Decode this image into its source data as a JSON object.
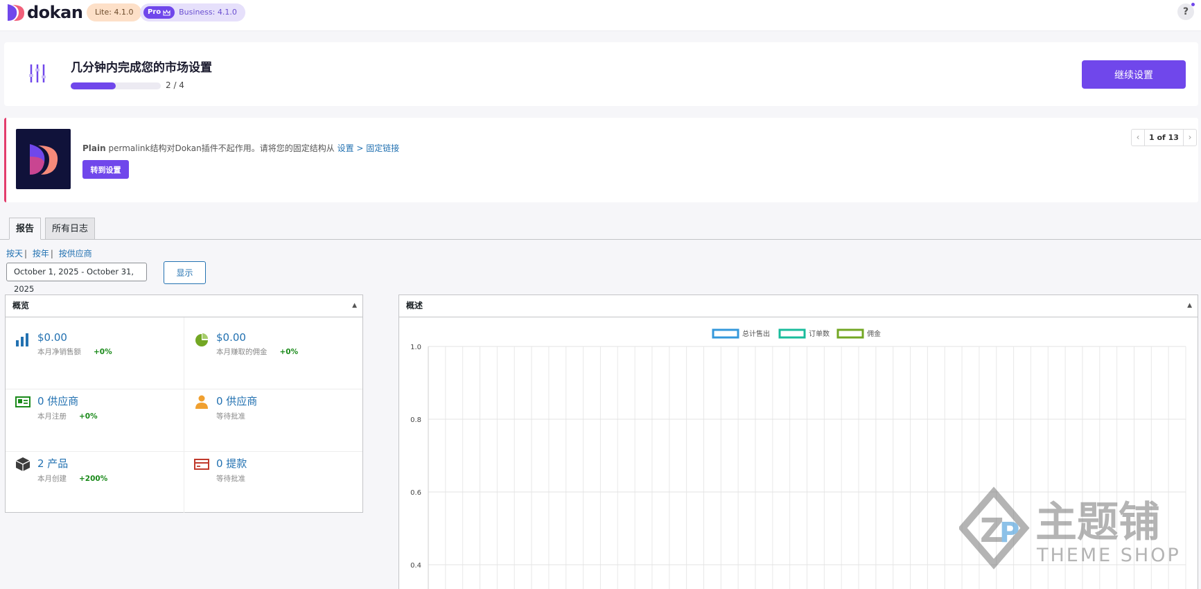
{
  "header": {
    "logo_text": "dokan",
    "lite_badge": "Lite: 4.1.0",
    "pro_label": "Pro",
    "business_badge": "Business: 4.1.0",
    "help_label": "?"
  },
  "setup": {
    "title": "几分钟内完成您的市场设置",
    "progress_text": "2 / 4",
    "progress_fraction": 0.5,
    "continue_label": "继续设置"
  },
  "notice": {
    "strong": "Plain",
    "text": " permalink结构对Dokan插件不起作用。请将您的固定结构从 ",
    "link1": "设置",
    "sep": " > ",
    "link2": "固定链接",
    "button_label": "转到设置",
    "pager_count": "1 of 13"
  },
  "tabs": [
    {
      "label": "报告",
      "active": true
    },
    {
      "label": "所有日志",
      "active": false
    }
  ],
  "sublinks": [
    "按天",
    "按年",
    "按供应商"
  ],
  "filter": {
    "date_range": "October 1, 2025 - October 31, 2025",
    "show_label": "显示"
  },
  "overview": {
    "title": "概览",
    "stats": [
      {
        "icon": "bar-chart-icon",
        "value": "$0.00",
        "label": "本月净销售额",
        "change": "+0%"
      },
      {
        "icon": "pie-chart-icon",
        "value": "$0.00",
        "label": "本月赚取的佣金",
        "change": "+0%"
      },
      {
        "icon": "id-card-icon",
        "value": "0 供应商",
        "label": "本月注册",
        "change": "+0%"
      },
      {
        "icon": "user-icon",
        "value": "0 供应商",
        "label": "等待批准",
        "change": ""
      },
      {
        "icon": "box-icon",
        "value": "2 产品",
        "label": "本月创建",
        "change": "+200%"
      },
      {
        "icon": "credit-card-icon",
        "value": "0 提款",
        "label": "等待批准",
        "change": ""
      }
    ]
  },
  "summary": {
    "title": "概述"
  },
  "chart_data": {
    "type": "line",
    "series": [
      {
        "name": "总计售出",
        "color": "#3498db",
        "values": []
      },
      {
        "name": "订单数",
        "color": "#1abc9c",
        "values": []
      },
      {
        "name": "佣金",
        "color": "#73a724",
        "values": []
      }
    ],
    "y_ticks": [
      "1.0",
      "0.8",
      "0.6",
      "0.4"
    ],
    "ylim": [
      0.4,
      1.0
    ],
    "grid": true,
    "legend": "top-center"
  },
  "watermark": {
    "main": "主题铺",
    "sub": "THEME SHOP"
  }
}
